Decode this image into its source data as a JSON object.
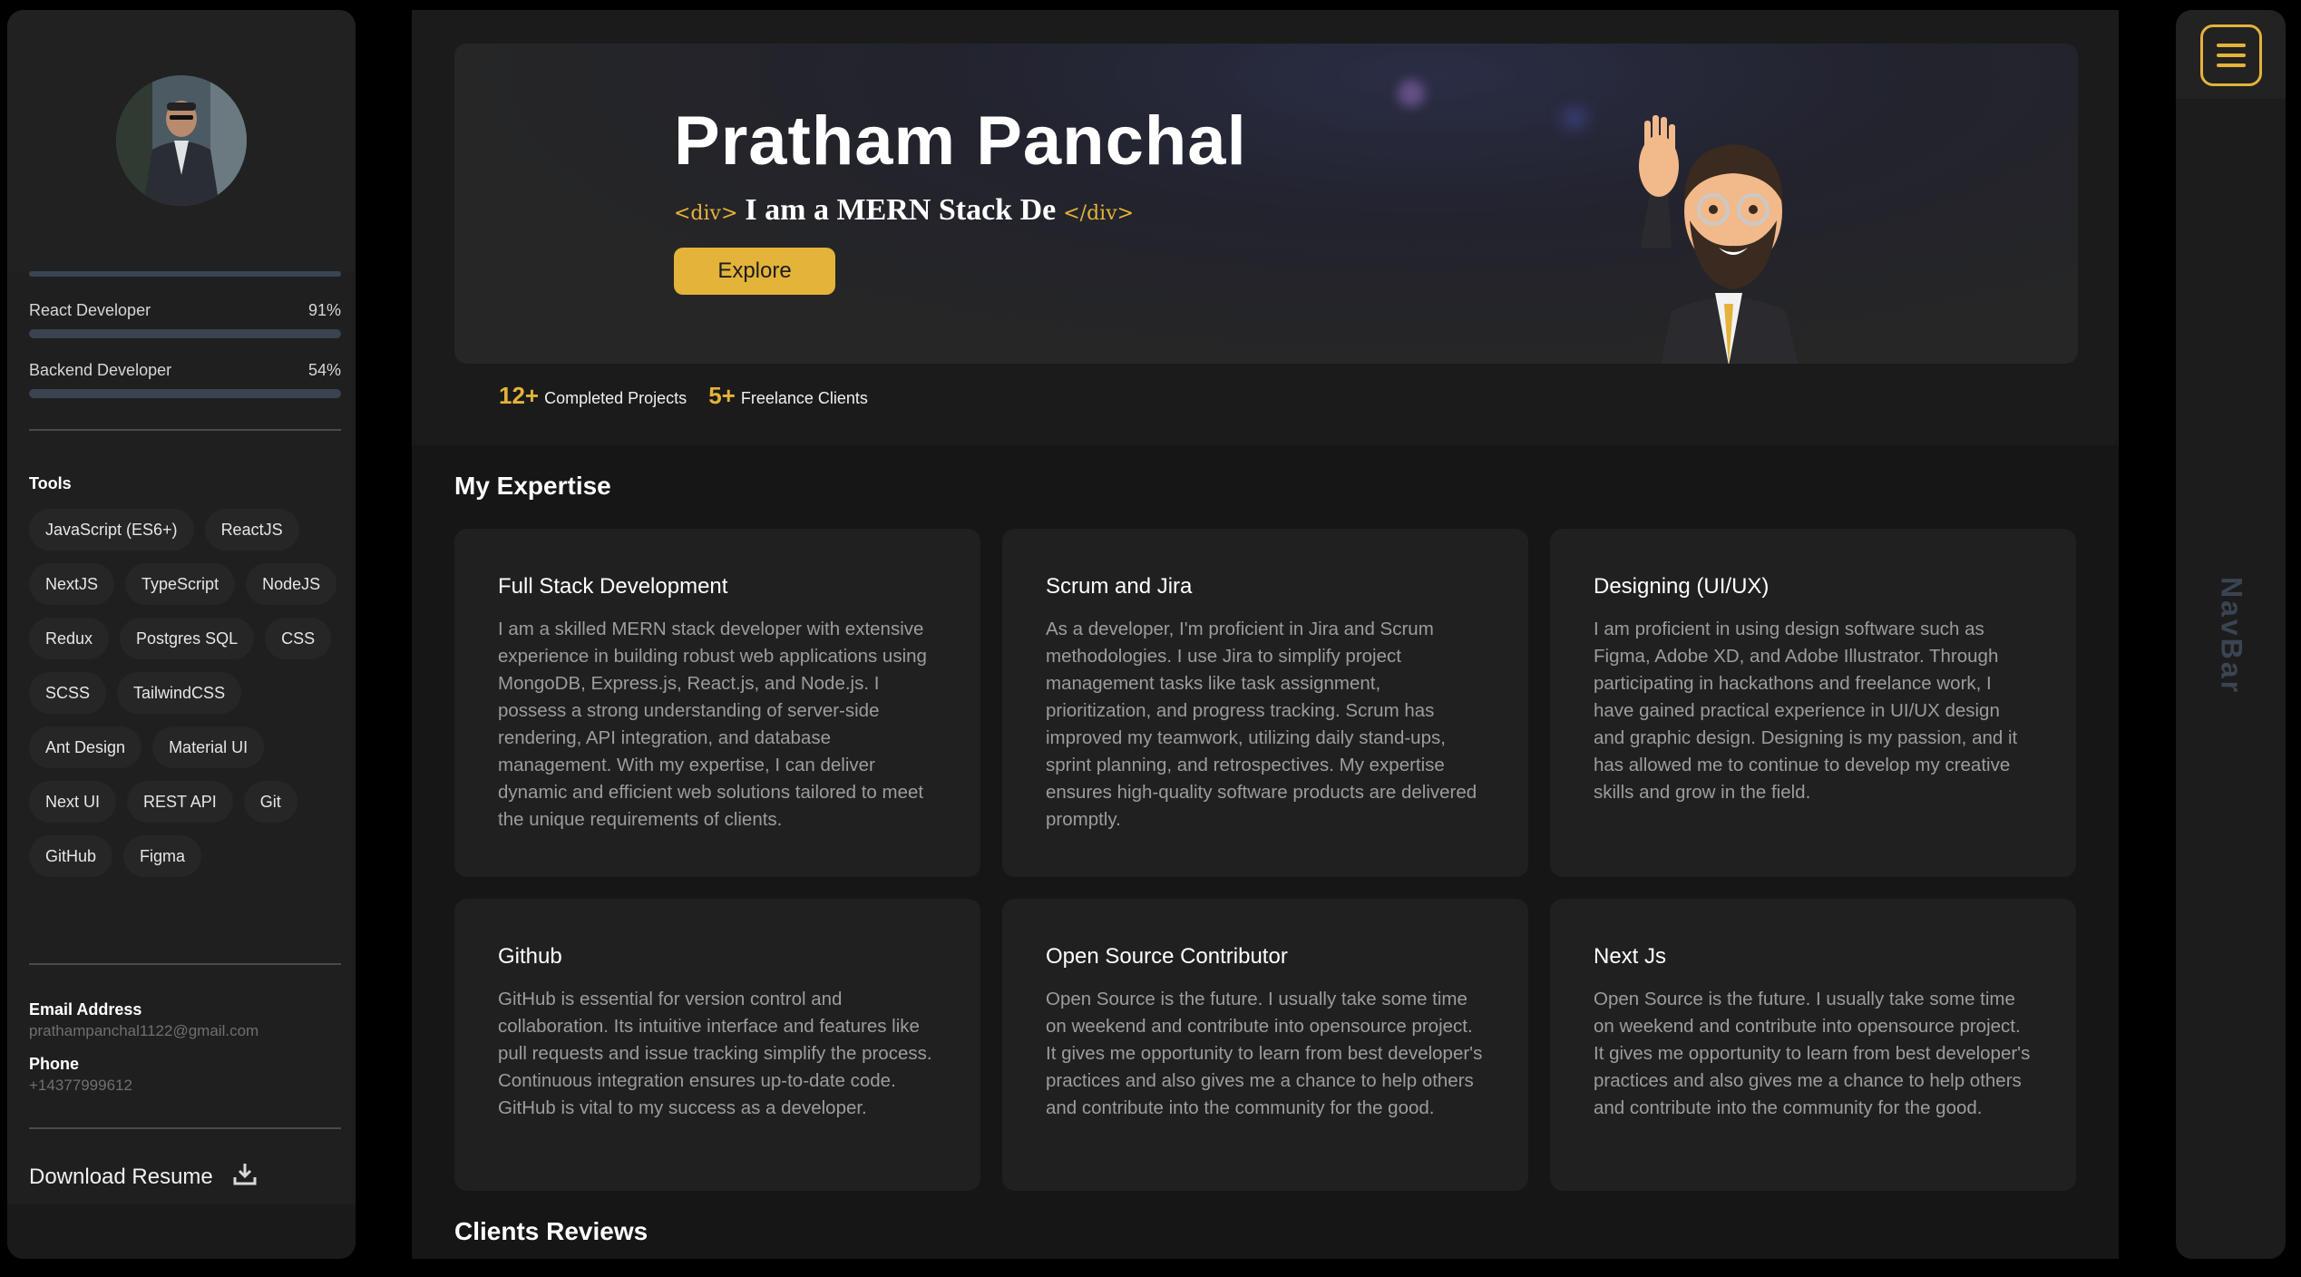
{
  "sidebar": {
    "skills": [
      {
        "label": "React Developer",
        "percent": "91%",
        "value": 0.91
      },
      {
        "label": "Backend Developer",
        "percent": "54%",
        "value": 0.54
      }
    ],
    "tools_title": "Tools",
    "tools": [
      "JavaScript (ES6+)",
      "ReactJS",
      "NextJS",
      "TypeScript",
      "NodeJS",
      "Redux",
      "Postgres SQL",
      "CSS",
      "SCSS",
      "TailwindCSS",
      "Ant Design",
      "Material UI",
      "Next UI",
      "REST API",
      "Git",
      "GitHub",
      "Figma"
    ],
    "email_label": "Email Address",
    "email": "prathampanchal1122@gmail.com",
    "phone_label": "Phone",
    "phone": "+14377999612",
    "download_label": "Download Resume"
  },
  "hero": {
    "name": "Pratham Panchal",
    "tag_open": "<div>",
    "typed": "I am a MERN Stack De",
    "tag_close": "</div>",
    "explore_label": "Explore",
    "stats": [
      {
        "num": "12+",
        "label": "Completed Projects"
      },
      {
        "num": "5+",
        "label": "Freelance Clients"
      }
    ]
  },
  "expertise": {
    "title": "My Expertise",
    "cards": [
      {
        "title": "Full Stack Development",
        "text": "I am a skilled MERN stack developer with extensive experience in building robust web applications using MongoDB, Express.js, React.js, and Node.js. I possess a strong understanding of server-side rendering, API integration, and database management. With my expertise, I can deliver dynamic and efficient web solutions tailored to meet the unique requirements of clients."
      },
      {
        "title": "Scrum and Jira",
        "text": "As a developer, I'm proficient in Jira and Scrum methodologies. I use Jira to simplify project management tasks like task assignment, prioritization, and progress tracking. Scrum has improved my teamwork, utilizing daily stand-ups, sprint planning, and retrospectives. My expertise ensures high-quality software products are delivered promptly."
      },
      {
        "title": "Designing (UI/UX)",
        "text": "I am proficient in using design software such as Figma, Adobe XD, and Adobe Illustrator. Through participating in hackathons and freelance work, I have gained practical experience in UI/UX design and graphic design. Designing is my passion, and it has allowed me to continue to develop my creative skills and grow in the field."
      },
      {
        "title": "Github",
        "text": "GitHub is essential for version control and collaboration. Its intuitive interface and features like pull requests and issue tracking simplify the process. Continuous integration ensures up-to-date code. GitHub is vital to my success as a developer."
      },
      {
        "title": "Open Source Contributor",
        "text": "Open Source is the future. I usually take some time on weekend and contribute into opensource project. It gives me opportunity to learn from best developer's practices and also gives me a chance to help others and contribute into the community for the good."
      },
      {
        "title": "Next Js",
        "text": "Open Source is the future. I usually take some time on weekend and contribute into opensource project. It gives me opportunity to learn from best developer's practices and also gives me a chance to help others and contribute into the community for the good."
      }
    ]
  },
  "reviews": {
    "title": "Clients Reviews"
  },
  "rightnav": {
    "label": "NavBar"
  },
  "colors": {
    "accent": "#e3b33a",
    "panel": "#1f1f1f",
    "card": "#202020",
    "background": "#161616"
  },
  "icons": {
    "menu": "hamburger-menu-icon",
    "download": "download-icon"
  }
}
